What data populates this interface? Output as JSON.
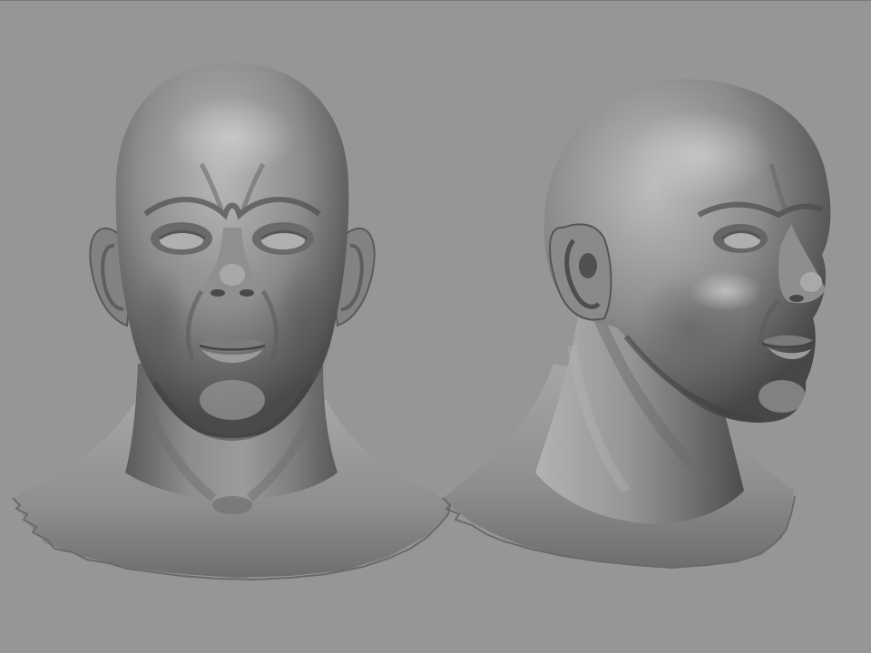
{
  "viewport": {
    "background_color": "#969696"
  },
  "sculpt_material": {
    "base_color": "#8e8e8e",
    "highlight_color": "#bdbdbd",
    "shadow_color": "#3e3e3e"
  },
  "models": [
    {
      "view": "front"
    },
    {
      "view": "three-quarter"
    }
  ]
}
